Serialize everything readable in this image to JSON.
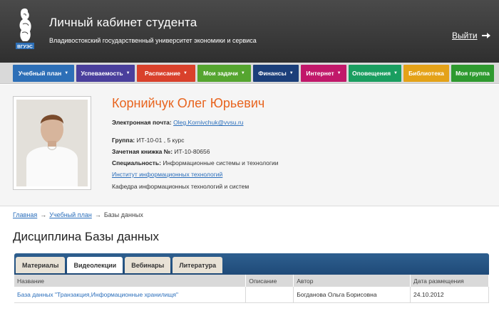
{
  "header": {
    "title": "Личный кабинет студента",
    "subtitle": "Владивостокский государственный университет экономики и сервиса",
    "logo_text": "ВГУЭС",
    "logout_label": "Выйти",
    "logout_icon": "arrow-right-icon"
  },
  "nav": {
    "items": [
      {
        "label": "Учебный план",
        "color": "#2d6fb7",
        "dropdown": true
      },
      {
        "label": "Успеваемость",
        "color": "#4a3f9c",
        "dropdown": true
      },
      {
        "label": "Расписание",
        "color": "#d9412b",
        "dropdown": true
      },
      {
        "label": "Мои задачи",
        "color": "#55a52f",
        "dropdown": true
      },
      {
        "label": "Финансы",
        "color": "#1b3f7a",
        "dropdown": true
      },
      {
        "label": "Интернет",
        "color": "#c1186a",
        "dropdown": true
      },
      {
        "label": "Оповещения",
        "color": "#1a9e60",
        "dropdown": true
      },
      {
        "label": "Библиотека",
        "color": "#e4a218",
        "dropdown": false
      },
      {
        "label": "Моя группа",
        "color": "#2e9a2f",
        "dropdown": false
      }
    ]
  },
  "profile": {
    "name": "Корнийчук Олег Юрьевич",
    "email_label": "Электронная почта:",
    "email": "Oleg.Kornivchuk@vvsu.ru",
    "group_label": "Группа:",
    "group": "ИТ-10-01 , 5 курс",
    "record_label": "Зачетная книжка №:",
    "record": "ИТ-10-80656",
    "specialty_label": "Специальность:",
    "specialty": "Информационные системы и технологии",
    "institute": "Институт информационных технологий",
    "department": "Кафедра информационных технологий и систем"
  },
  "breadcrumb": {
    "home": "Главная",
    "plan": "Учебный план",
    "current": "Базы данных",
    "separator": "→"
  },
  "discipline_title": "Дисциплина Базы данных",
  "tabs": [
    {
      "label": "Материалы",
      "active": false
    },
    {
      "label": "Видеолекции",
      "active": true
    },
    {
      "label": "Вебинары",
      "active": false
    },
    {
      "label": "Литература",
      "active": false
    }
  ],
  "table": {
    "headers": [
      "Название",
      "Описание",
      "Автор",
      "Дата размещения"
    ],
    "rows": [
      [
        "База данных \"Транзакция,Информационные хранилищя\"",
        "",
        "Богданова Ольга Борисовна",
        "24.10.2012"
      ]
    ]
  }
}
